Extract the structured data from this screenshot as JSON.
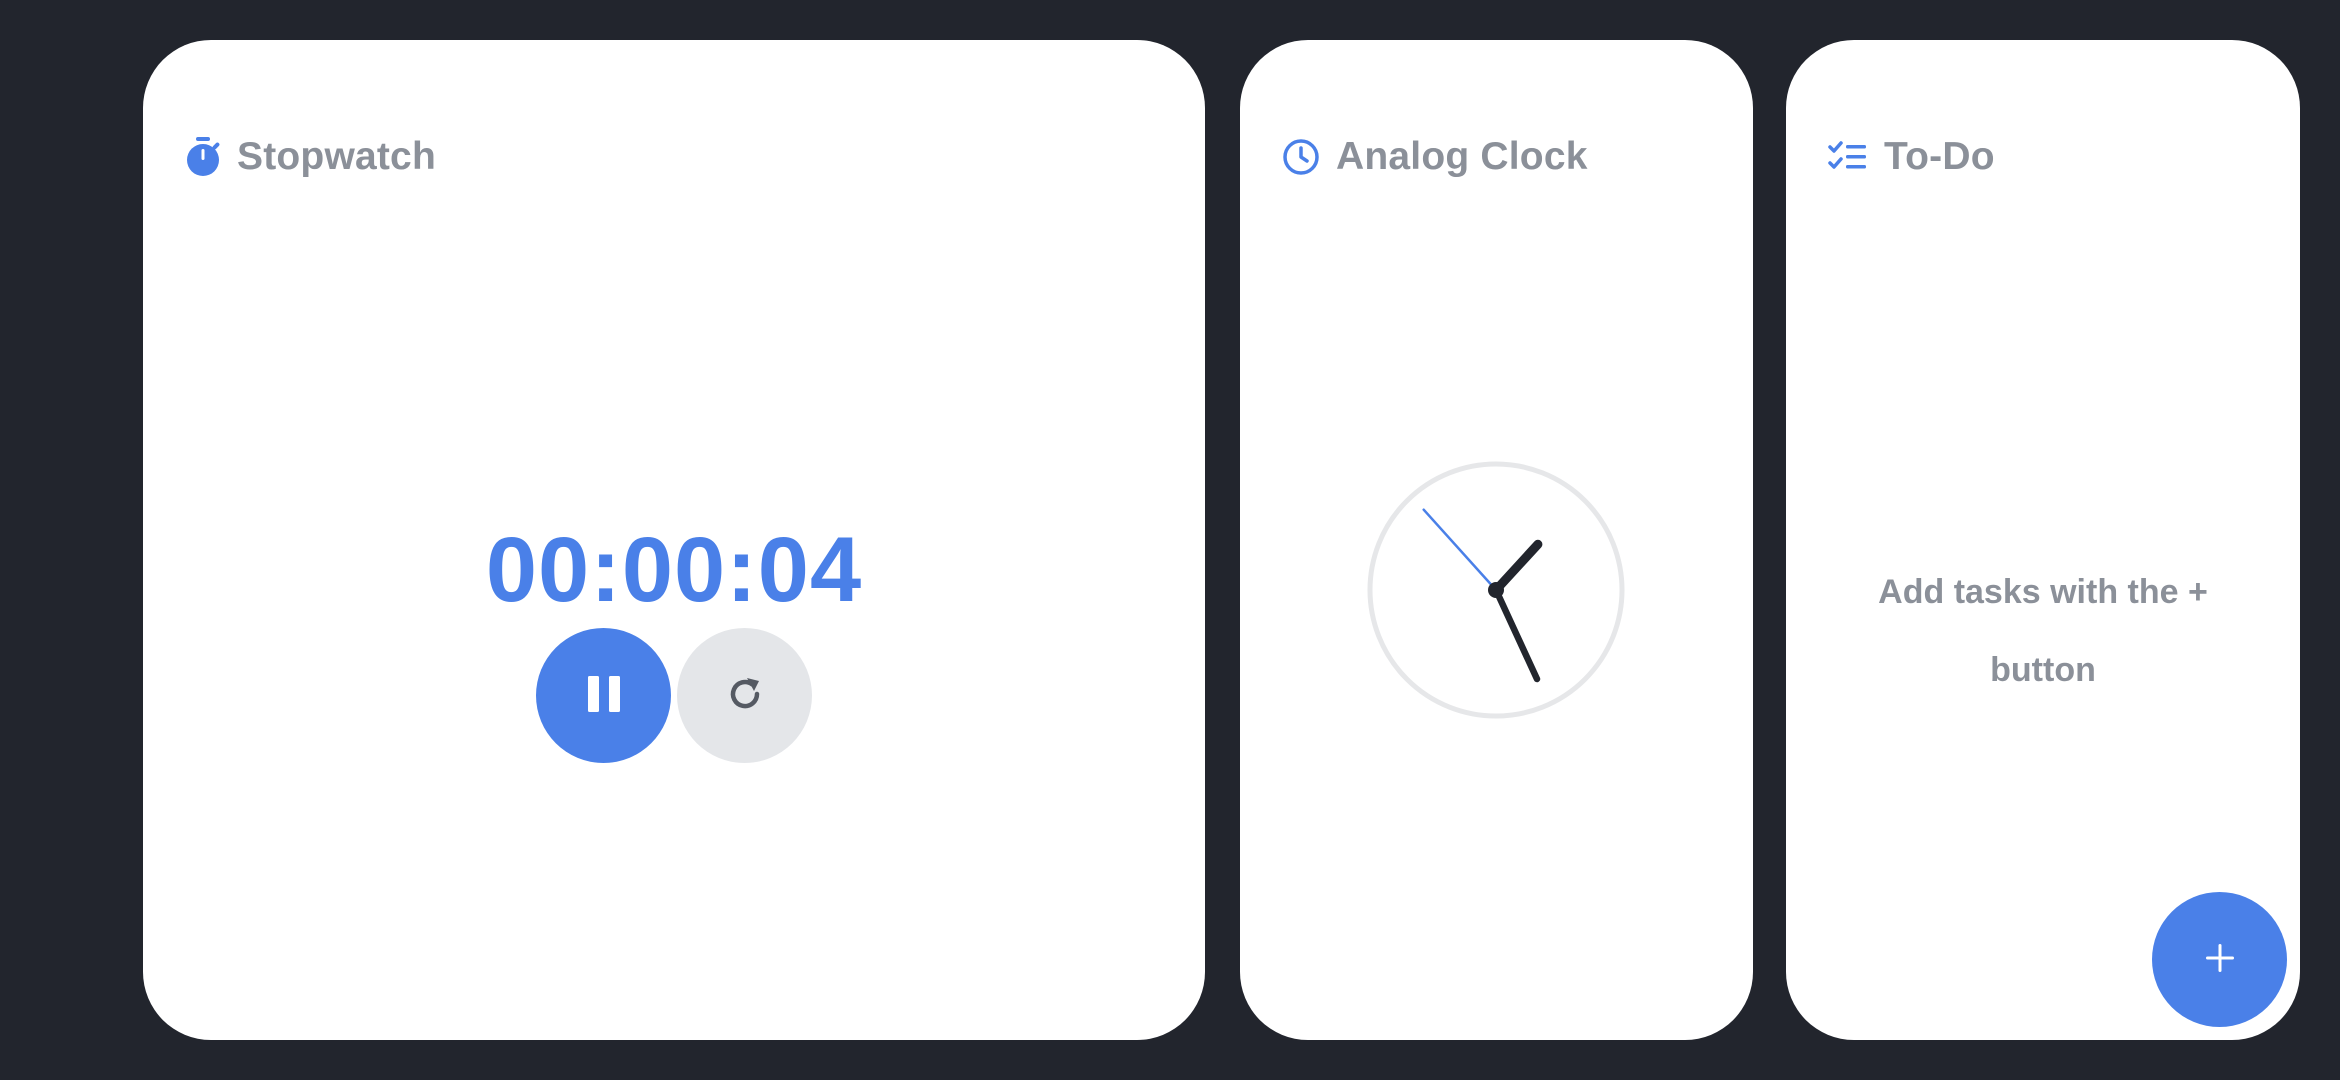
{
  "colors": {
    "background": "#22252d",
    "card": "#ffffff",
    "accent": "#4a80e8",
    "title_gray": "#8b9099",
    "reset_bg": "#e4e6e9"
  },
  "stopwatch": {
    "icon": "stopwatch-icon",
    "title": "Stopwatch",
    "time": "00:00:04",
    "pause_icon": "pause-icon",
    "reset_icon": "reset-icon"
  },
  "clock": {
    "icon": "clock-icon",
    "title": "Analog Clock",
    "time_shown": {
      "hours": 1,
      "minutes": 25,
      "seconds": 53
    }
  },
  "todo": {
    "icon": "checklist-icon",
    "title": "To-Do",
    "empty_message": "Add tasks with the + button",
    "add_icon": "plus-icon"
  }
}
